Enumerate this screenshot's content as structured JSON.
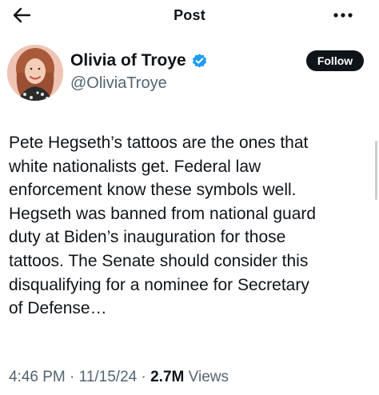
{
  "header": {
    "title": "Post"
  },
  "author": {
    "name": "Olivia of Troye",
    "handle": "@OliviaTroye",
    "follow_label": "Follow"
  },
  "tweet": {
    "lines": [
      "Pete Hegseth’s tattoos are the ones that",
      "white nationalists get. Federal law",
      "enforcement know these symbols well.",
      "Hegseth was banned from national guard",
      "duty at Biden’s inauguration for those",
      "tattoos. The Senate should consider this",
      "disqualifying for a nominee for Secretary",
      "of Defense…"
    ]
  },
  "meta": {
    "time": "4:46 PM",
    "separator": " · ",
    "date": "11/15/24",
    "views_count": "2.7M",
    "views_label": " Views"
  },
  "colors": {
    "text_primary": "#0f1419",
    "text_secondary": "#536471",
    "verified_blue": "#1d9bf0",
    "follow_bg": "#0f1419"
  },
  "icons": {
    "back": "arrow-left-icon",
    "more": "more-horizontal-icon",
    "verified": "verified-badge-icon"
  }
}
